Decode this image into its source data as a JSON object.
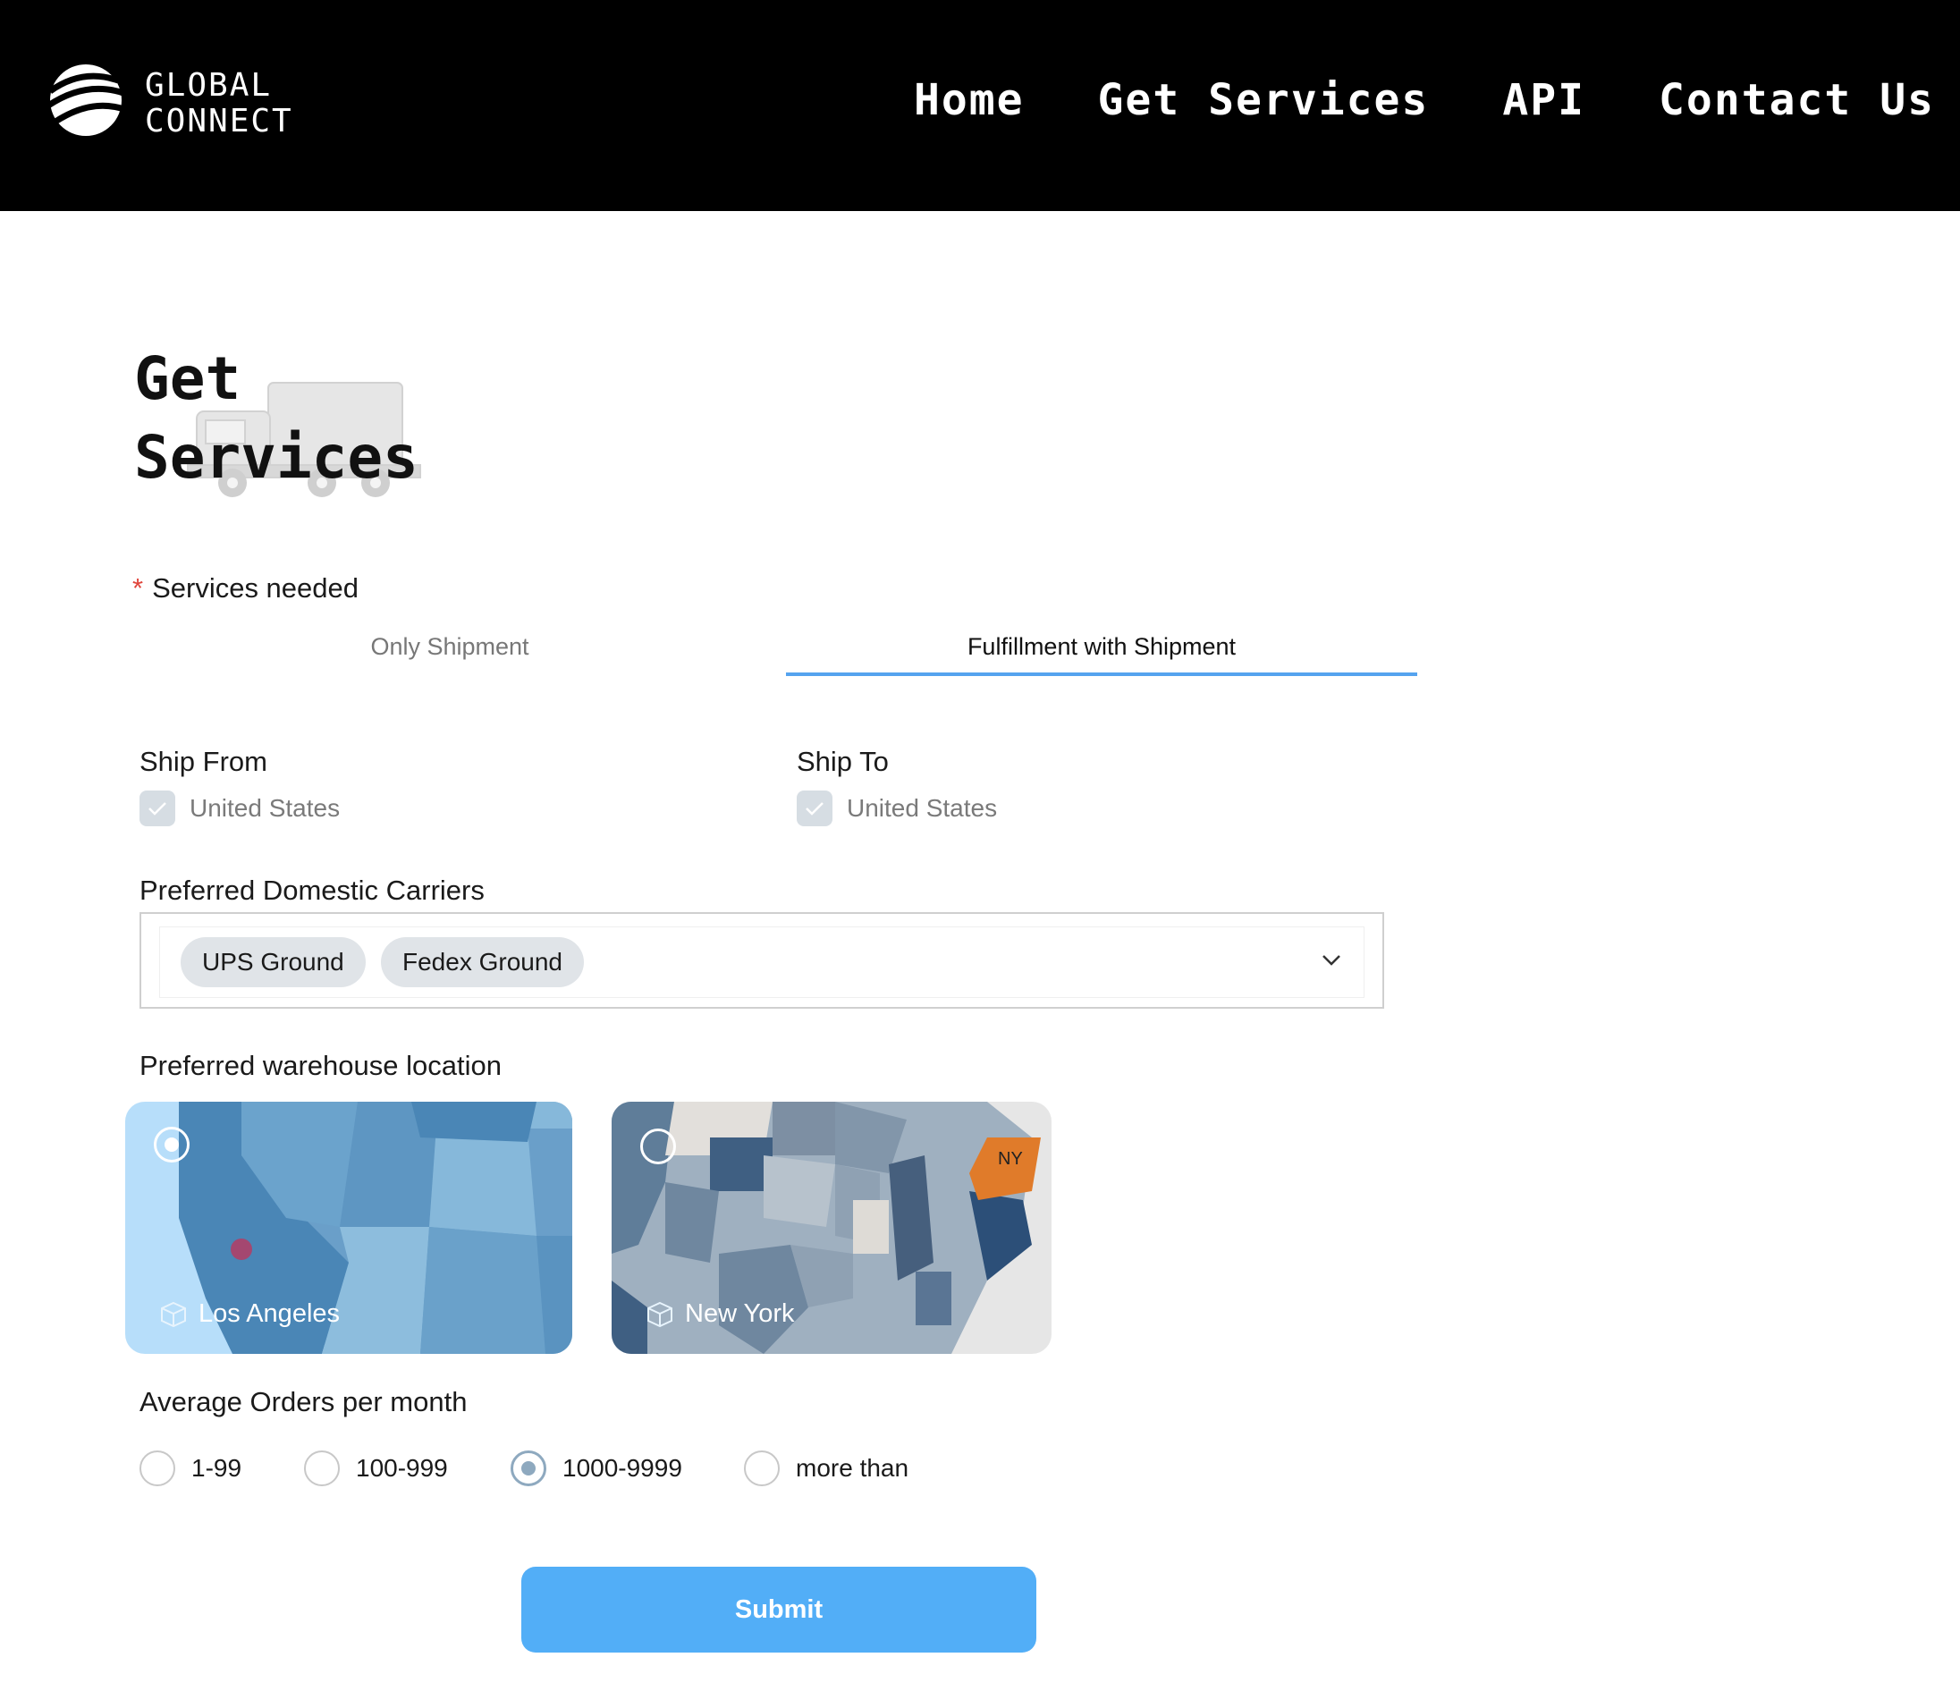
{
  "header": {
    "logo": {
      "line1": "GLOBAL",
      "line2": "CONNECT"
    },
    "nav": [
      {
        "label": "Home"
      },
      {
        "label": "Get Services"
      },
      {
        "label": "API"
      },
      {
        "label": "Contact Us"
      }
    ]
  },
  "page": {
    "title_line1": "Get",
    "title_line2": "Services"
  },
  "form": {
    "services_needed": {
      "required_mark": "*",
      "label": "Services needed",
      "tabs": [
        {
          "label": "Only Shipment",
          "active": false
        },
        {
          "label": "Fulfillment with Shipment",
          "active": true
        }
      ]
    },
    "ship_from": {
      "label": "Ship From",
      "option": "United States",
      "checked": true
    },
    "ship_to": {
      "label": "Ship To",
      "option": "United States",
      "checked": true
    },
    "carriers": {
      "label": "Preferred Domestic Carriers",
      "selected": [
        "UPS Ground",
        "Fedex Ground"
      ]
    },
    "warehouse": {
      "label": "Preferred warehouse location",
      "options": [
        {
          "name": "Los Angeles",
          "selected": true
        },
        {
          "name": "New York",
          "selected": false,
          "badge": "NY"
        }
      ]
    },
    "orders": {
      "label": "Average Orders per month",
      "options": [
        "1-99",
        "100-999",
        "1000-9999",
        "more than"
      ],
      "selected": "1000-9999"
    },
    "submit_label": "Submit"
  },
  "colors": {
    "header_bg": "#000000",
    "accent": "#55a3ef",
    "submit_bg": "#52aef7",
    "required": "#e0453c",
    "ny_highlight": "#e07b2a"
  }
}
